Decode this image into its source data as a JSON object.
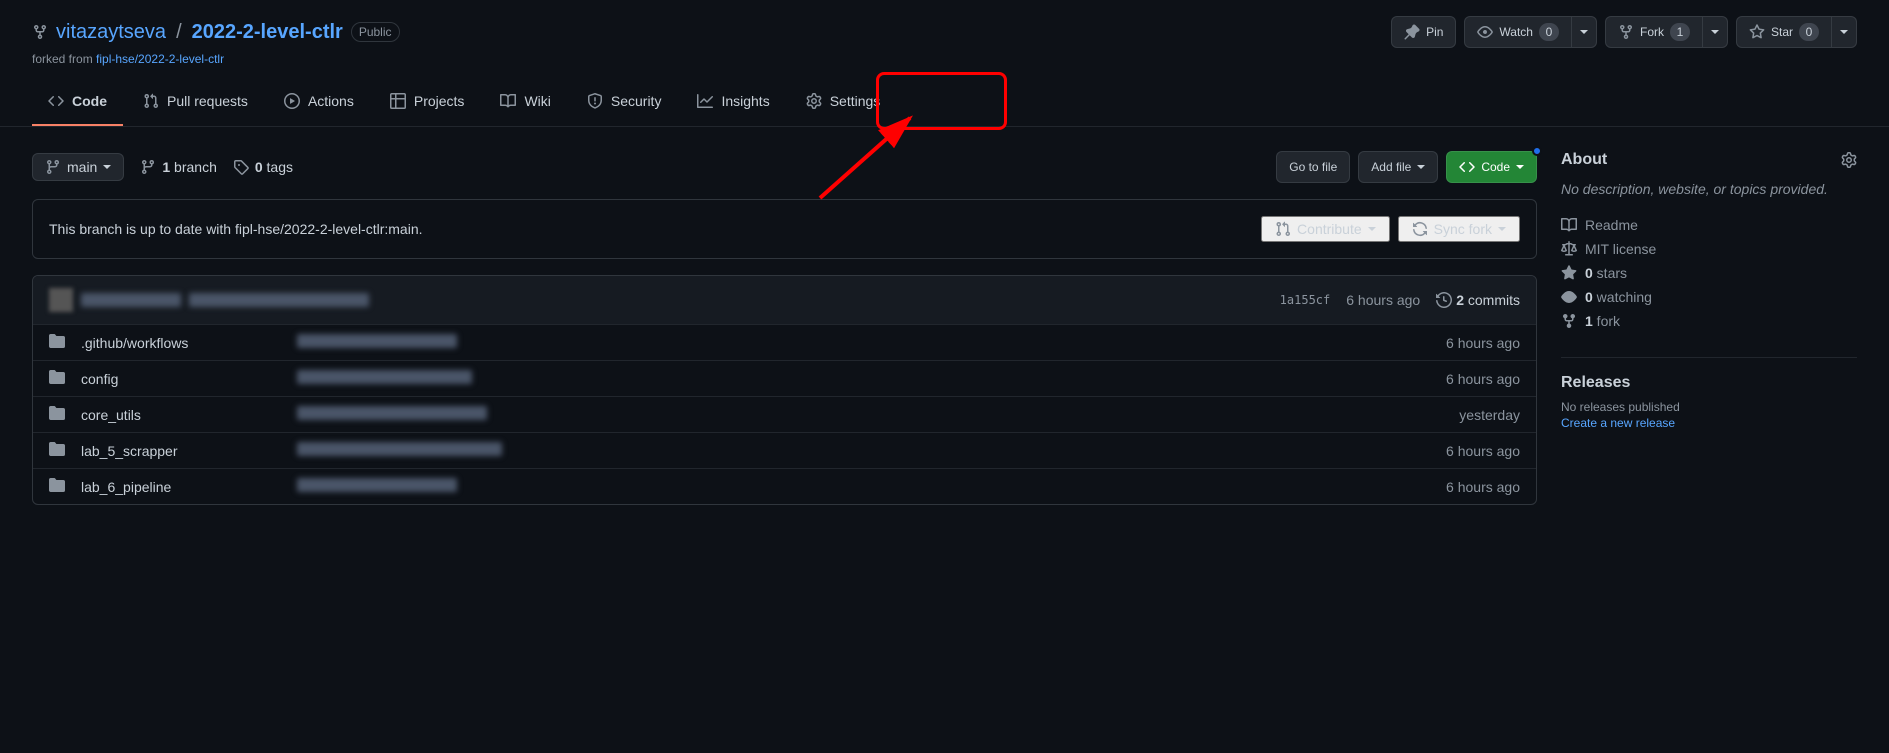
{
  "header": {
    "owner": "vitazaytseva",
    "repo": "2022-2-level-ctlr",
    "separator": "/",
    "visibility": "Public",
    "forked_prefix": "forked from ",
    "forked_from": "fipl-hse/2022-2-level-ctlr"
  },
  "actions": {
    "pin": "Pin",
    "watch": "Watch",
    "watch_count": "0",
    "fork": "Fork",
    "fork_count": "1",
    "star": "Star",
    "star_count": "0"
  },
  "nav": {
    "code": "Code",
    "pull_requests": "Pull requests",
    "actions": "Actions",
    "projects": "Projects",
    "wiki": "Wiki",
    "security": "Security",
    "insights": "Insights",
    "settings": "Settings"
  },
  "file_bar": {
    "branch": "main",
    "branch_count": "1",
    "branch_label": " branch",
    "tag_count": "0",
    "tag_label": " tags",
    "goto_file": "Go to file",
    "add_file": "Add file",
    "code_btn": "Code"
  },
  "notice": {
    "text": "This branch is up to date with fipl-hse/2022-2-level-ctlr:main.",
    "contribute": "Contribute",
    "sync_fork": "Sync fork"
  },
  "commits": {
    "hash": "1a155cf",
    "time": "6 hours ago",
    "count": "2",
    "label": " commits"
  },
  "files": [
    {
      "name": ".github/workflows",
      "time": "6 hours ago"
    },
    {
      "name": "config",
      "time": "6 hours ago"
    },
    {
      "name": "core_utils",
      "time": "yesterday"
    },
    {
      "name": "lab_5_scrapper",
      "time": "6 hours ago"
    },
    {
      "name": "lab_6_pipeline",
      "time": "6 hours ago"
    }
  ],
  "about": {
    "title": "About",
    "desc": "No description, website, or topics provided.",
    "readme": "Readme",
    "license": "MIT license",
    "stars_count": "0",
    "stars_label": " stars",
    "watching_count": "0",
    "watching_label": " watching",
    "forks_count": "1",
    "forks_label": " fork"
  },
  "releases": {
    "title": "Releases",
    "none": "No releases published",
    "create": "Create a new release"
  }
}
